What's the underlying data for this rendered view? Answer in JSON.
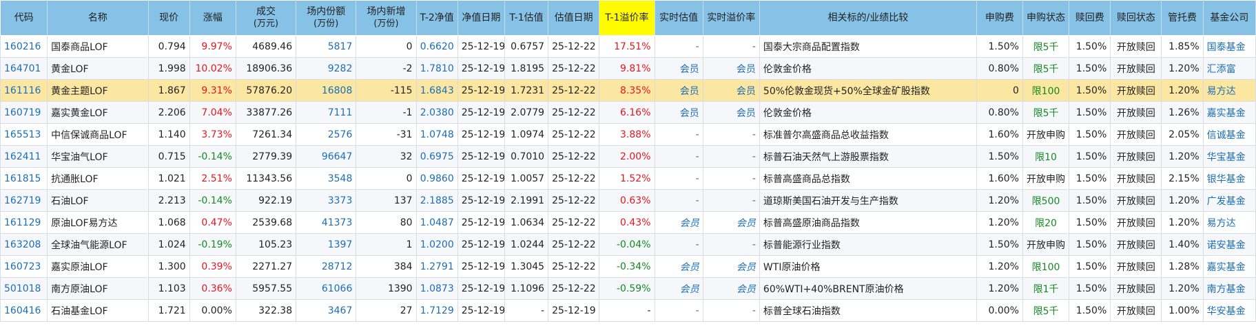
{
  "headers": [
    {
      "main": "代码",
      "sub": ""
    },
    {
      "main": "名称",
      "sub": ""
    },
    {
      "main": "现价",
      "sub": ""
    },
    {
      "main": "涨幅",
      "sub": ""
    },
    {
      "main": "成交",
      "sub": "(万元)"
    },
    {
      "main": "场内份额",
      "sub": "(万份)"
    },
    {
      "main": "场内新增",
      "sub": "(万份)"
    },
    {
      "main": "T-2净值",
      "sub": ""
    },
    {
      "main": "净值日期",
      "sub": ""
    },
    {
      "main": "T-1估值",
      "sub": ""
    },
    {
      "main": "估值日期",
      "sub": ""
    },
    {
      "main": "T-1溢价率",
      "sub": ""
    },
    {
      "main": "实时估值",
      "sub": ""
    },
    {
      "main": "实时溢价率",
      "sub": ""
    },
    {
      "main": "相关标的/业绩比较",
      "sub": ""
    },
    {
      "main": "申购费",
      "sub": ""
    },
    {
      "main": "申购状态",
      "sub": ""
    },
    {
      "main": "赎回费",
      "sub": ""
    },
    {
      "main": "赎回状态",
      "sub": ""
    },
    {
      "main": "管托费",
      "sub": ""
    },
    {
      "main": "基金公司",
      "sub": ""
    }
  ],
  "rows": [
    {
      "code": "160216",
      "name": "国泰商品LOF",
      "price": "0.794",
      "change": "9.97%",
      "change_dir": "up",
      "volume": "4689.46",
      "shares": "5817",
      "new_shares": "0",
      "nav_t2": "0.6620",
      "nav_date": "25-12-19",
      "est_t1": "0.6757",
      "est_date": "25-12-22",
      "premium_t1": "17.51%",
      "prem_dir": "up",
      "rt_est": "-",
      "rt_premium": "-",
      "rt_style": "dash",
      "benchmark": "国泰大宗商品配置指数",
      "sub_fee": "1.50%",
      "sub_status": "限5千",
      "sub_status_color": "green",
      "red_fee": "1.50%",
      "red_status": "开放赎回",
      "mgmt_fee": "1.85%",
      "company": "国泰基金"
    },
    {
      "code": "164701",
      "name": "黄金LOF",
      "price": "1.998",
      "change": "10.02%",
      "change_dir": "up",
      "volume": "18906.36",
      "shares": "9282",
      "new_shares": "-2",
      "nav_t2": "1.7810",
      "nav_date": "25-12-19",
      "est_t1": "1.8195",
      "est_date": "25-12-22",
      "premium_t1": "9.81%",
      "prem_dir": "up",
      "rt_est": "会员",
      "rt_premium": "会员",
      "rt_style": "member",
      "benchmark": "伦敦金价格",
      "sub_fee": "0.80%",
      "sub_status": "限5千",
      "sub_status_color": "green",
      "red_fee": "1.50%",
      "red_status": "开放赎回",
      "mgmt_fee": "1.20%",
      "company": "汇添富"
    },
    {
      "code": "161116",
      "name": "黄金主题LOF",
      "price": "1.867",
      "change": "9.31%",
      "change_dir": "up",
      "volume": "57876.20",
      "shares": "16808",
      "new_shares": "-115",
      "nav_t2": "1.6843",
      "nav_date": "25-12-19",
      "est_t1": "1.7231",
      "est_date": "25-12-22",
      "premium_t1": "8.35%",
      "prem_dir": "up",
      "rt_est": "会员",
      "rt_premium": "会员",
      "rt_style": "member",
      "benchmark": "50%伦敦金现货+50%全球金矿股指数",
      "sub_fee": "0",
      "sub_status": "限100",
      "sub_status_color": "green",
      "red_fee": "1.50%",
      "red_status": "开放赎回",
      "mgmt_fee": "1.20%",
      "company": "易方达",
      "selected": true
    },
    {
      "code": "160719",
      "name": "嘉实黄金LOF",
      "price": "2.206",
      "change": "7.04%",
      "change_dir": "up",
      "volume": "33877.26",
      "shares": "7111",
      "new_shares": "-1",
      "nav_t2": "2.0380",
      "nav_date": "25-12-19",
      "est_t1": "2.0779",
      "est_date": "25-12-22",
      "premium_t1": "6.16%",
      "prem_dir": "up",
      "rt_est": "会员",
      "rt_premium": "会员",
      "rt_style": "member",
      "benchmark": "伦敦金价格",
      "sub_fee": "0.80%",
      "sub_status": "限5千",
      "sub_status_color": "green",
      "red_fee": "1.50%",
      "red_status": "开放赎回",
      "mgmt_fee": "1.26%",
      "company": "嘉实基金"
    },
    {
      "code": "165513",
      "name": "中信保诚商品LOF",
      "price": "1.140",
      "change": "3.73%",
      "change_dir": "up",
      "volume": "7261.34",
      "shares": "2576",
      "new_shares": "-31",
      "nav_t2": "1.0748",
      "nav_date": "25-12-19",
      "est_t1": "1.0974",
      "est_date": "25-12-22",
      "premium_t1": "3.88%",
      "prem_dir": "up",
      "rt_est": "-",
      "rt_premium": "-",
      "rt_style": "dash",
      "benchmark": "标准普尔高盛商品总收益指数",
      "sub_fee": "1.60%",
      "sub_status": "开放申购",
      "sub_status_color": "normal",
      "red_fee": "1.50%",
      "red_status": "开放赎回",
      "mgmt_fee": "2.05%",
      "company": "信诚基金"
    },
    {
      "code": "162411",
      "name": "华宝油气LOF",
      "price": "0.715",
      "change": "-0.14%",
      "change_dir": "down",
      "volume": "2779.39",
      "shares": "96647",
      "new_shares": "32",
      "nav_t2": "0.6975",
      "nav_date": "25-12-19",
      "est_t1": "0.7010",
      "est_date": "25-12-22",
      "premium_t1": "2.00%",
      "prem_dir": "up",
      "rt_est": "-",
      "rt_premium": "-",
      "rt_style": "dash",
      "benchmark": "标普石油天然气上游股票指数",
      "sub_fee": "1.50%",
      "sub_status": "限10",
      "sub_status_color": "green",
      "red_fee": "1.50%",
      "red_status": "开放赎回",
      "mgmt_fee": "1.20%",
      "company": "华宝基金"
    },
    {
      "code": "161815",
      "name": "抗通胀LOF",
      "price": "1.021",
      "change": "2.51%",
      "change_dir": "up",
      "volume": "11343.56",
      "shares": "3548",
      "new_shares": "0",
      "nav_t2": "0.9860",
      "nav_date": "25-12-19",
      "est_t1": "1.0057",
      "est_date": "25-12-22",
      "premium_t1": "1.52%",
      "prem_dir": "up",
      "rt_est": "-",
      "rt_premium": "-",
      "rt_style": "dash",
      "benchmark": "标普高盛商品总指数",
      "sub_fee": "1.60%",
      "sub_status": "开放申购",
      "sub_status_color": "normal",
      "red_fee": "1.50%",
      "red_status": "开放赎回",
      "mgmt_fee": "2.15%",
      "company": "银华基金"
    },
    {
      "code": "162719",
      "name": "石油LOF",
      "price": "2.213",
      "change": "-0.14%",
      "change_dir": "down",
      "volume": "922.19",
      "shares": "3373",
      "new_shares": "137",
      "nav_t2": "2.1885",
      "nav_date": "25-12-19",
      "est_t1": "2.1991",
      "est_date": "25-12-22",
      "premium_t1": "0.63%",
      "prem_dir": "up",
      "rt_est": "-",
      "rt_premium": "-",
      "rt_style": "dash",
      "benchmark": "道琼斯美国石油开发与生产指数",
      "sub_fee": "1.20%",
      "sub_status": "限500",
      "sub_status_color": "green",
      "red_fee": "1.50%",
      "red_status": "开放赎回",
      "mgmt_fee": "1.20%",
      "company": "广发基金"
    },
    {
      "code": "161129",
      "name": "原油LOF易方达",
      "price": "1.068",
      "change": "0.47%",
      "change_dir": "up",
      "volume": "2539.68",
      "shares": "41373",
      "new_shares": "80",
      "nav_t2": "1.0487",
      "nav_date": "25-12-19",
      "est_t1": "1.0634",
      "est_date": "25-12-22",
      "premium_t1": "0.43%",
      "prem_dir": "up",
      "rt_est": "会员",
      "rt_premium": "会员",
      "rt_style": "member-ital",
      "benchmark": "标普高盛原油商品指数",
      "sub_fee": "1.20%",
      "sub_status": "限20",
      "sub_status_color": "green",
      "red_fee": "1.50%",
      "red_status": "开放赎回",
      "mgmt_fee": "1.20%",
      "company": "易方达"
    },
    {
      "code": "163208",
      "name": "全球油气能源LOF",
      "price": "1.024",
      "change": "-0.19%",
      "change_dir": "down",
      "volume": "105.23",
      "shares": "1397",
      "new_shares": "1",
      "nav_t2": "1.0200",
      "nav_date": "25-12-19",
      "est_t1": "1.0244",
      "est_date": "25-12-22",
      "premium_t1": "-0.04%",
      "prem_dir": "down",
      "rt_est": "-",
      "rt_premium": "-",
      "rt_style": "dash",
      "benchmark": "标普能源行业指数",
      "sub_fee": "1.50%",
      "sub_status": "开放申购",
      "sub_status_color": "normal",
      "red_fee": "1.50%",
      "red_status": "开放赎回",
      "mgmt_fee": "1.40%",
      "company": "诺安基金"
    },
    {
      "code": "160723",
      "name": "嘉实原油LOF",
      "price": "1.300",
      "change": "0.39%",
      "change_dir": "up",
      "volume": "2271.27",
      "shares": "28712",
      "new_shares": "384",
      "nav_t2": "1.2791",
      "nav_date": "25-12-19",
      "est_t1": "1.3045",
      "est_date": "25-12-22",
      "premium_t1": "-0.34%",
      "prem_dir": "down",
      "rt_est": "会员",
      "rt_premium": "会员",
      "rt_style": "member-ital",
      "benchmark": "WTI原油价格",
      "sub_fee": "1.20%",
      "sub_status": "限100",
      "sub_status_color": "green",
      "red_fee": "1.50%",
      "red_status": "开放赎回",
      "mgmt_fee": "1.28%",
      "company": "嘉实基金"
    },
    {
      "code": "501018",
      "name": "南方原油LOF",
      "price": "1.103",
      "change": "0.36%",
      "change_dir": "up",
      "volume": "5957.55",
      "shares": "61066",
      "new_shares": "1390",
      "nav_t2": "1.0873",
      "nav_date": "25-12-19",
      "est_t1": "1.1096",
      "est_date": "25-12-22",
      "premium_t1": "-0.59%",
      "prem_dir": "down",
      "rt_est": "会员",
      "rt_premium": "会员",
      "rt_style": "member-ital",
      "benchmark": "60%WTI+40%BRENT原油价格",
      "sub_fee": "1.20%",
      "sub_status": "限1千",
      "sub_status_color": "green",
      "red_fee": "1.50%",
      "red_status": "开放赎回",
      "mgmt_fee": "1.20%",
      "company": "南方基金"
    },
    {
      "code": "160416",
      "name": "石油基金LOF",
      "price": "1.721",
      "change": "0.00%",
      "change_dir": "flat",
      "volume": "322.38",
      "shares": "3467",
      "new_shares": "27",
      "nav_t2": "1.7129",
      "nav_date": "25-12-19",
      "est_t1": "-",
      "est_date": "25-12-19",
      "premium_t1": "-",
      "prem_dir": "flat",
      "rt_est": "-",
      "rt_premium": "-",
      "rt_style": "dash",
      "benchmark": "标普全球石油指数",
      "sub_fee": "0.00%",
      "sub_status": "限5千",
      "sub_status_color": "green",
      "red_fee": "1.50%",
      "red_status": "开放赎回",
      "mgmt_fee": "1.00%",
      "company": "华安基金"
    }
  ],
  "colors": {
    "header_bg": "#86c1e6",
    "highlight_header": "#fffc00",
    "selected_row": "#fbe7a1",
    "up": "#e8161c",
    "down": "#128a21",
    "link": "#1a6db8"
  }
}
